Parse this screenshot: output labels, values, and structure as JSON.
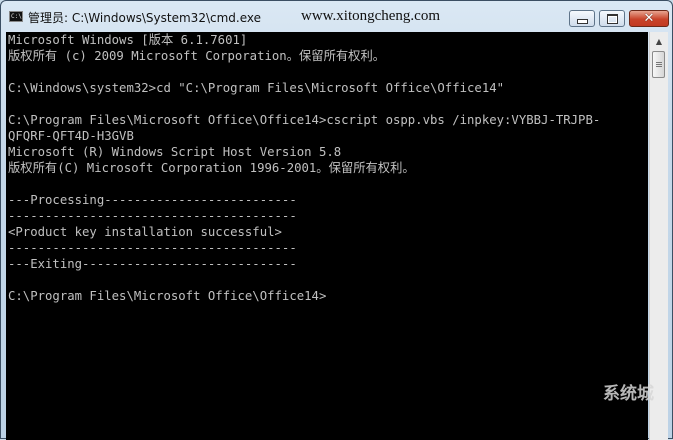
{
  "window": {
    "title": "管理员: C:\\Windows\\System32\\cmd.exe",
    "icon": "cmd-icon",
    "icon_text": "C:\\",
    "watermark": "www.xitongcheng.com",
    "controls": {
      "minimize_icon": "minimize-icon",
      "maximize_icon": "maximize-icon",
      "close_icon": "close-icon",
      "close_glyph": "✕"
    }
  },
  "console": {
    "lines": [
      "Microsoft Windows [版本 6.1.7601]",
      "版权所有 (c) 2009 Microsoft Corporation。保留所有权利。",
      "",
      "C:\\Windows\\system32>cd \"C:\\Program Files\\Microsoft Office\\Office14\"",
      "",
      "C:\\Program Files\\Microsoft Office\\Office14>cscript ospp.vbs /inpkey:VYBBJ-TRJPB-",
      "QFQRF-QFT4D-H3GVB",
      "Microsoft (R) Windows Script Host Version 5.8",
      "版权所有(C) Microsoft Corporation 1996-2001。保留所有权利。",
      "",
      "---Processing--------------------------",
      "---------------------------------------",
      "<Product key installation successful>",
      "---------------------------------------",
      "---Exiting-----------------------------",
      "",
      "C:\\Program Files\\Microsoft Office\\Office14>"
    ]
  },
  "scrollbar": {
    "up_arrow": "▲"
  },
  "corner_watermark": "系统城"
}
